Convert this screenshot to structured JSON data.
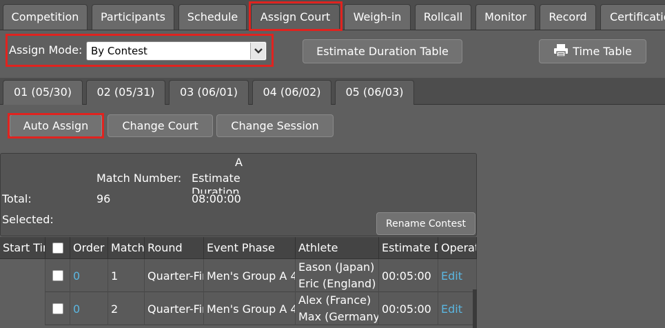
{
  "nav": {
    "tabs": [
      "Competition",
      "Participants",
      "Schedule",
      "Assign Court",
      "Weigh-in",
      "Rollcall",
      "Monitor",
      "Record",
      "Certification"
    ],
    "active": "Assign Court"
  },
  "toolbar": {
    "mode_label": "Assign Mode:",
    "mode_value": "By Contest",
    "estimate_button": "Estimate Duration Table",
    "time_table_button": "Time Table"
  },
  "days": {
    "tabs": [
      "01 (05/30)",
      "02 (05/31)",
      "03 (06/01)",
      "04 (06/02)",
      "05 (06/03)"
    ],
    "active": "01 (05/30)"
  },
  "actions": {
    "auto_assign": "Auto Assign",
    "change_court": "Change Court",
    "change_session": "Change Session"
  },
  "summary": {
    "court": "A",
    "match_number_label": "Match Number:",
    "estimate_label": "Estimate Duration",
    "total_label": "Total:",
    "total_matches": "96",
    "total_duration": "08:00:00",
    "selected_label": "Selected:",
    "rename_button": "Rename Contest"
  },
  "table": {
    "headers": [
      "Start Time",
      "",
      "Order",
      "Match",
      "Round",
      "Event Phase",
      "Athlete",
      "Estimate Duration",
      "Operation"
    ],
    "rows": [
      {
        "order": "0",
        "match": "1",
        "round": "Quarter-Final",
        "phase": "Men's Group A 4",
        "athlete1": "Eason (Japan)",
        "athlete2": "Eric (England)",
        "duration": "00:05:00",
        "op": "Edit"
      },
      {
        "order": "0",
        "match": "2",
        "round": "Quarter-Final",
        "phase": "Men's Group A 4",
        "athlete1": "Alex (France)",
        "athlete2": "Max (Germany)",
        "duration": "00:05:00",
        "op": "Edit"
      }
    ]
  },
  "colors": {
    "highlight": "#e0231f",
    "link": "#5bb6e0"
  }
}
